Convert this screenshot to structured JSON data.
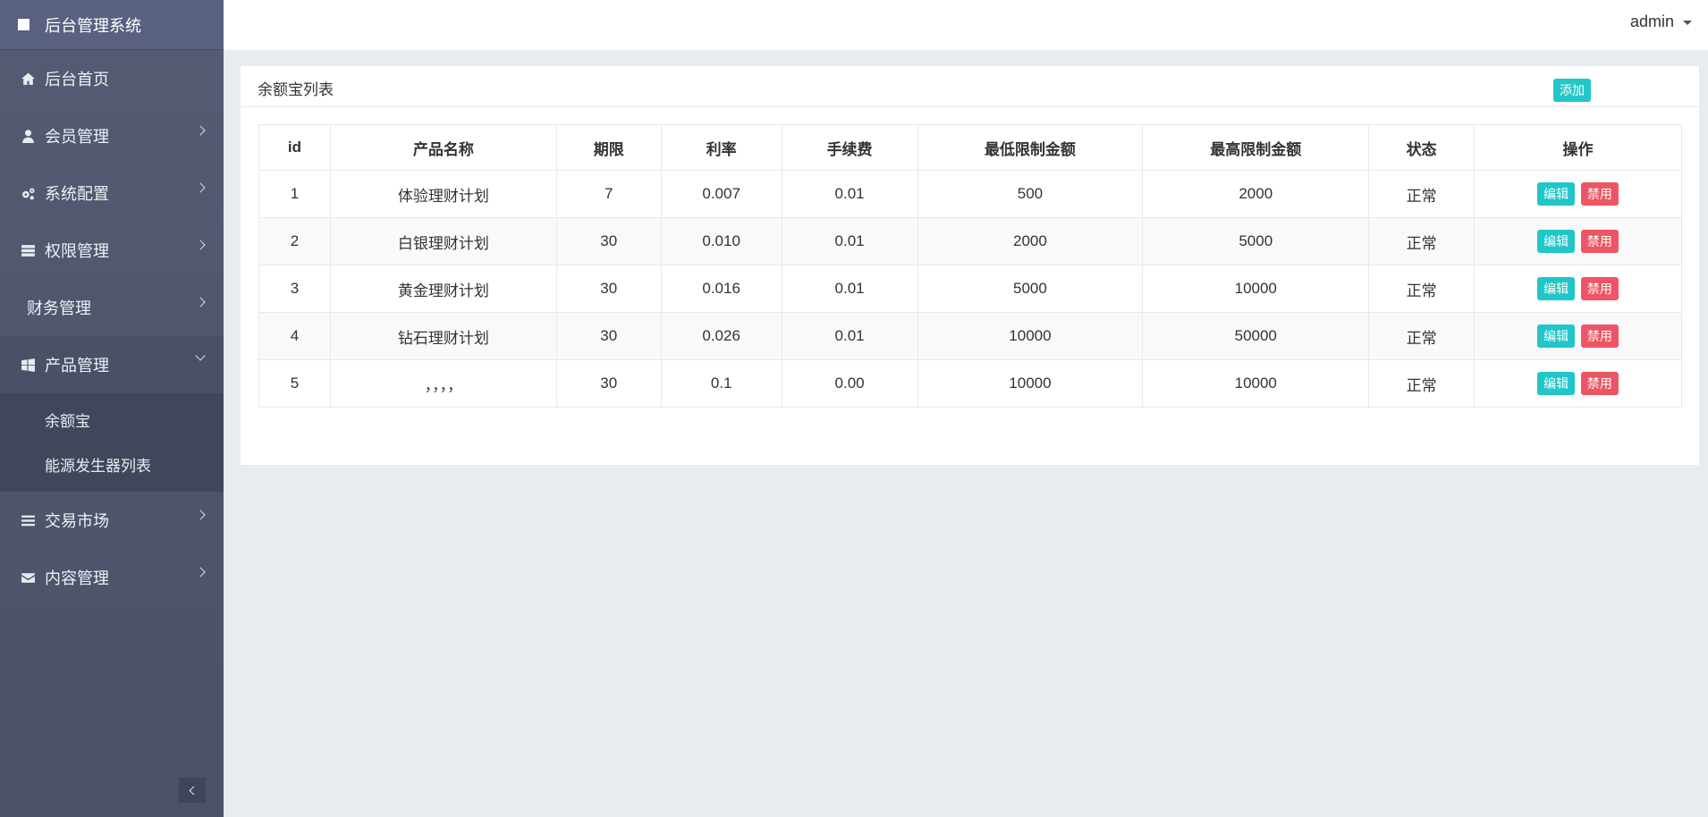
{
  "brand": {
    "title": "后台管理系统"
  },
  "sidebar": {
    "items": [
      {
        "label": "后台首页",
        "icon": "home-icon"
      },
      {
        "label": "会员管理",
        "icon": "user-icon"
      },
      {
        "label": "系统配置",
        "icon": "gears-icon"
      },
      {
        "label": "权限管理",
        "icon": "server-icon"
      },
      {
        "label": "财务管理",
        "icon": ""
      },
      {
        "label": "产品管理",
        "icon": "windows-icon",
        "open": true
      },
      {
        "label": "交易市场",
        "icon": "bars-icon"
      },
      {
        "label": "内容管理",
        "icon": "envelope-icon"
      }
    ],
    "submenu": [
      {
        "label": "余额宝"
      },
      {
        "label": "能源发生器列表"
      }
    ]
  },
  "topbar": {
    "user": "admin"
  },
  "panel": {
    "title": "余额宝列表",
    "add_label": "添加"
  },
  "table": {
    "headers": [
      "id",
      "产品名称",
      "期限",
      "利率",
      "手续费",
      "最低限制金额",
      "最高限制金额",
      "状态",
      "操作"
    ],
    "rows": [
      [
        "1",
        "体验理财计划",
        "7",
        "0.007",
        "0.01",
        "500",
        "2000",
        "正常"
      ],
      [
        "2",
        "白银理财计划",
        "30",
        "0.010",
        "0.01",
        "2000",
        "5000",
        "正常"
      ],
      [
        "3",
        "黄金理财计划",
        "30",
        "0.016",
        "0.01",
        "5000",
        "10000",
        "正常"
      ],
      [
        "4",
        "钻石理财计划",
        "30",
        "0.026",
        "0.01",
        "10000",
        "50000",
        "正常"
      ],
      [
        "5",
        "，，，，",
        "30",
        "0.1",
        "0.00",
        "10000",
        "10000",
        "正常"
      ]
    ],
    "edit_label": "编辑",
    "disable_label": "禁用"
  },
  "colors": {
    "sidebar_bg": "#4f566c",
    "info": "#23c6c8",
    "danger": "#ed5565"
  }
}
